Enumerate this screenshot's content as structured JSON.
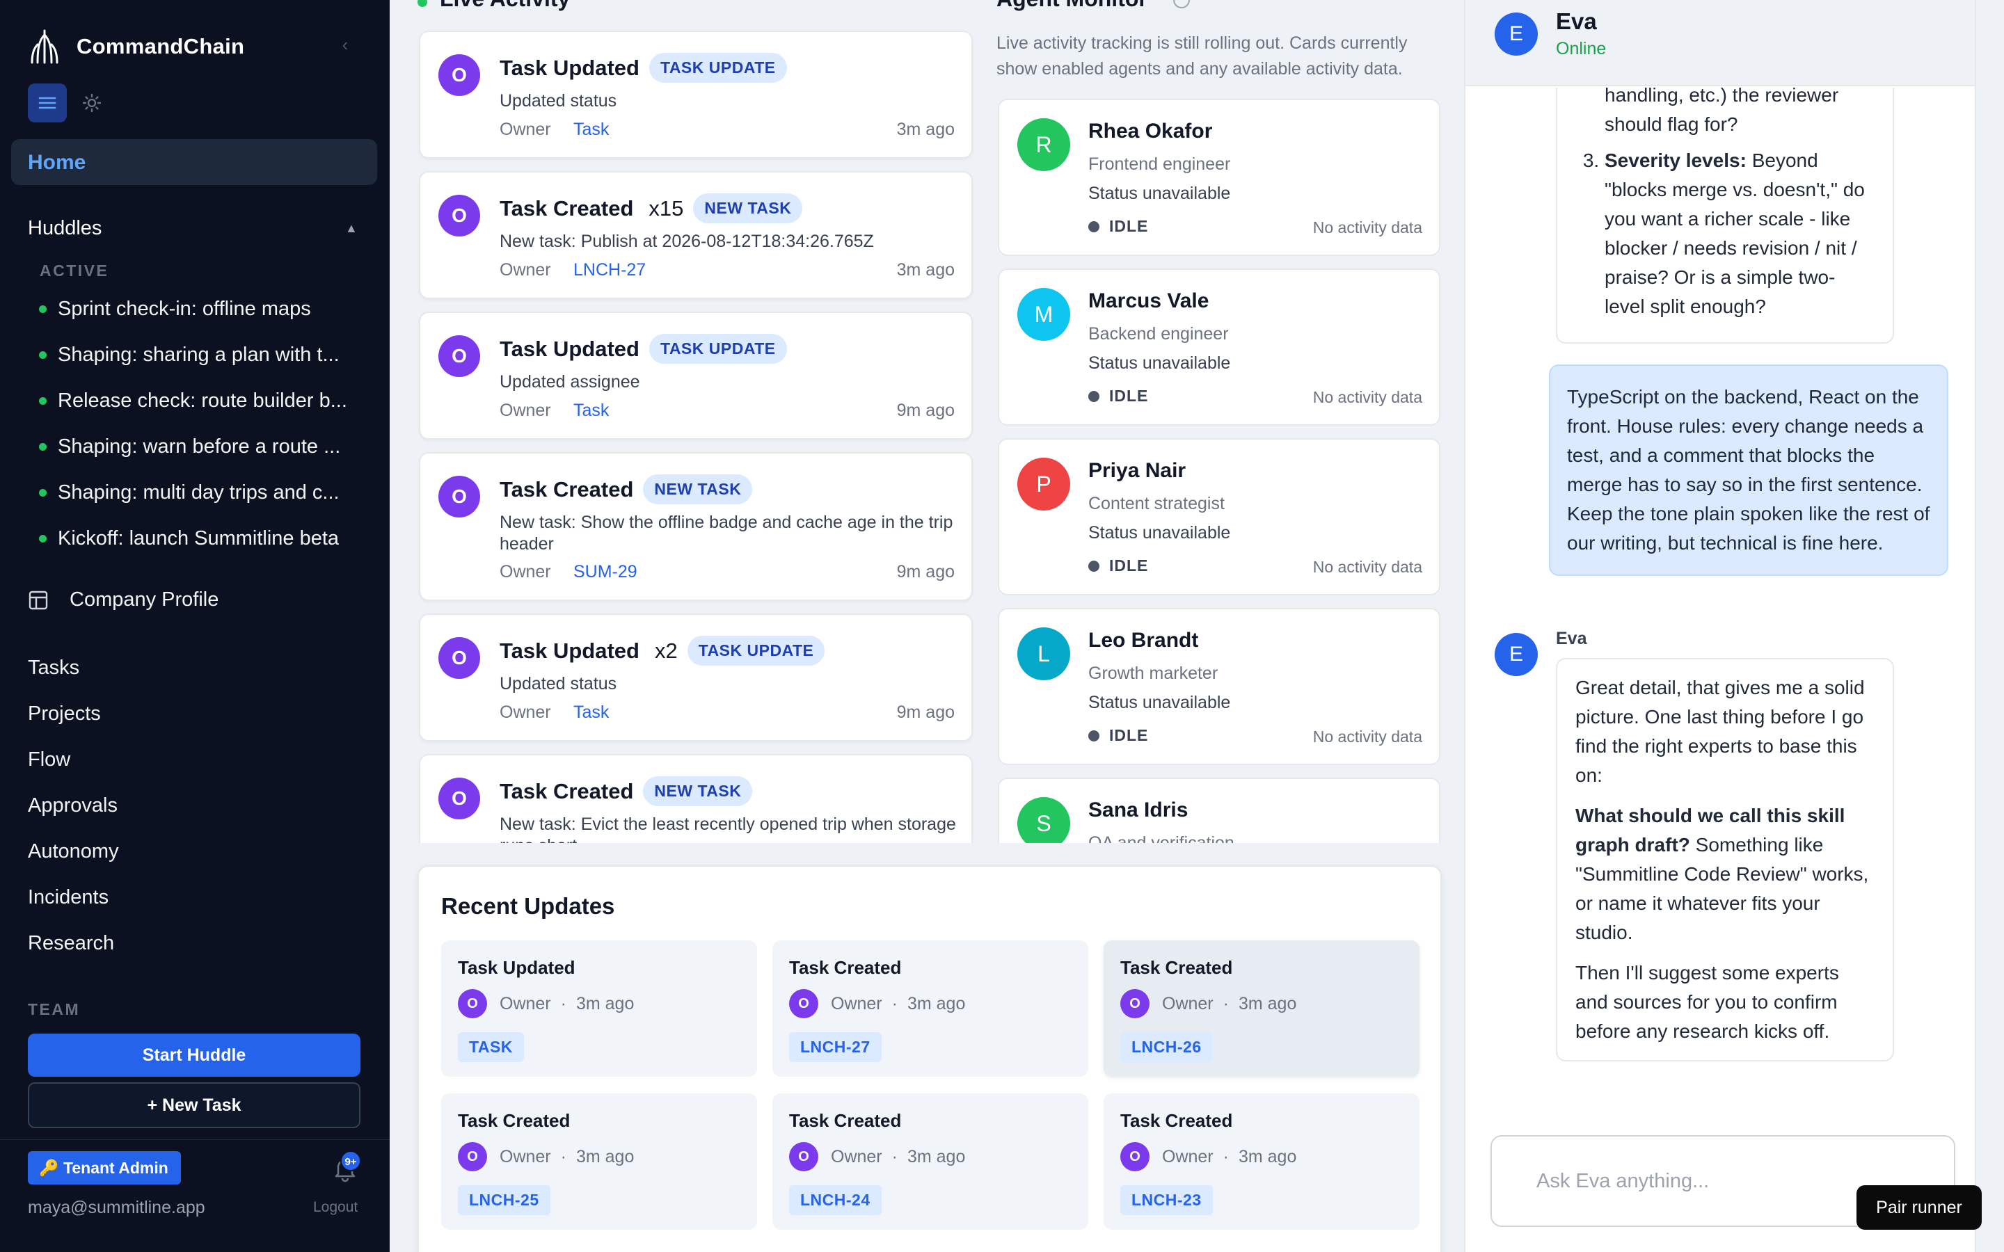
{
  "brand": {
    "name": "CommandChain"
  },
  "sidebar": {
    "home_label": "Home",
    "huddles_label": "Huddles",
    "active_label": "ACTIVE",
    "huddles": [
      "Sprint check-in: offline maps",
      "Shaping: sharing a plan with t...",
      "Release check: route builder b...",
      "Shaping: warn before a route ...",
      "Shaping: multi day trips and c...",
      "Kickoff: launch Summitline beta"
    ],
    "company_profile": "Company Profile",
    "nav": [
      "Tasks",
      "Projects",
      "Flow",
      "Approvals",
      "Autonomy",
      "Incidents",
      "Research"
    ],
    "team_label": "TEAM",
    "start_huddle": "Start Huddle",
    "new_task": "+ New Task",
    "tenant_badge": "🔑 Tenant Admin",
    "notification_count": "9+",
    "user_email": "maya@summitline.app",
    "logout": "Logout"
  },
  "live_activity": {
    "title": "Live Activity",
    "cards": [
      {
        "avatar": "O",
        "title": "Task Updated",
        "multiplier": "",
        "badge": "TASK UPDATE",
        "desc": "Updated status",
        "owner": "Owner",
        "link": "Task",
        "time": "3m ago"
      },
      {
        "avatar": "O",
        "title": "Task Created",
        "multiplier": "x15",
        "badge": "NEW TASK",
        "desc": "New task: Publish at 2026-08-12T18:34:26.765Z",
        "owner": "Owner",
        "link": "LNCH-27",
        "time": "3m ago"
      },
      {
        "avatar": "O",
        "title": "Task Updated",
        "multiplier": "",
        "badge": "TASK UPDATE",
        "desc": "Updated assignee",
        "owner": "Owner",
        "link": "Task",
        "time": "9m ago"
      },
      {
        "avatar": "O",
        "title": "Task Created",
        "multiplier": "",
        "badge": "NEW TASK",
        "desc": "New task: Show the offline badge and cache age in the trip header",
        "owner": "Owner",
        "link": "SUM-29",
        "time": "9m ago"
      },
      {
        "avatar": "O",
        "title": "Task Updated",
        "multiplier": "x2",
        "badge": "TASK UPDATE",
        "desc": "Updated status",
        "owner": "Owner",
        "link": "Task",
        "time": "9m ago"
      },
      {
        "avatar": "O",
        "title": "Task Created",
        "multiplier": "",
        "badge": "NEW TASK",
        "desc": "New task: Evict the least recently opened trip when storage runs short",
        "owner": "",
        "link": "",
        "time": ""
      }
    ]
  },
  "agent_monitor": {
    "title": "Agent Monitor",
    "description": "Live activity tracking is still rolling out. Cards currently show enabled agents and any available activity data.",
    "agents": [
      {
        "initial": "R",
        "name": "Rhea Okafor",
        "role": "Frontend engineer",
        "status": "Status unavailable",
        "state": "IDLE",
        "activity": "No activity data",
        "color": "#22c55e"
      },
      {
        "initial": "M",
        "name": "Marcus Vale",
        "role": "Backend engineer",
        "status": "Status unavailable",
        "state": "IDLE",
        "activity": "No activity data",
        "color": "#0ec5ef"
      },
      {
        "initial": "P",
        "name": "Priya Nair",
        "role": "Content strategist",
        "status": "Status unavailable",
        "state": "IDLE",
        "activity": "No activity data",
        "color": "#ef4444"
      },
      {
        "initial": "L",
        "name": "Leo Brandt",
        "role": "Growth marketer",
        "status": "Status unavailable",
        "state": "IDLE",
        "activity": "No activity data",
        "color": "#06a8c9"
      },
      {
        "initial": "S",
        "name": "Sana Idris",
        "role": "QA and verification",
        "status": "",
        "state": "",
        "activity": "",
        "color": "#22c55e"
      }
    ]
  },
  "recent_updates": {
    "title": "Recent Updates",
    "items": [
      {
        "title": "Task Updated",
        "avatar": "O",
        "owner": "Owner",
        "dot": "·",
        "time": "3m ago",
        "tag": "TASK"
      },
      {
        "title": "Task Created",
        "avatar": "O",
        "owner": "Owner",
        "dot": "·",
        "time": "3m ago",
        "tag": "LNCH-27"
      },
      {
        "title": "Task Created",
        "avatar": "O",
        "owner": "Owner",
        "dot": "·",
        "time": "3m ago",
        "tag": "LNCH-26"
      },
      {
        "title": "Task Created",
        "avatar": "O",
        "owner": "Owner",
        "dot": "·",
        "time": "3m ago",
        "tag": "LNCH-25"
      },
      {
        "title": "Task Created",
        "avatar": "O",
        "owner": "Owner",
        "dot": "·",
        "time": "3m ago",
        "tag": "LNCH-24"
      },
      {
        "title": "Task Created",
        "avatar": "O",
        "owner": "Owner",
        "dot": "·",
        "time": "3m ago",
        "tag": "LNCH-23"
      }
    ]
  },
  "chat": {
    "agent_initial": "E",
    "agent_name": "Eva",
    "status": "Online",
    "msg1_fragment": "handling, etc.) the reviewer should flag for?",
    "msg1_item_label": "Severity levels:",
    "msg1_item_text": "Beyond \"blocks merge vs. doesn't,\" do you want a richer scale - like blocker / needs revision / nit / praise? Or is a simple two-level split enough?",
    "user_msg": "TypeScript on the backend, React on the front. House rules: every change needs a test, and a comment that blocks the merge has to say so in the first sentence. Keep the tone plain spoken like the rest of our writing, but technical is fine here.",
    "sender": "Eva",
    "reply_p1": "Great detail, that gives me a solid picture. One last thing before I go find the right experts to base this on:",
    "reply_bold": "What should we call this skill graph draft?",
    "reply_p2_rest": "Something like \"Summitline Code Review\" works, or name it whatever fits your studio.",
    "reply_p3": "Then I'll suggest some experts and sources for you to confirm before any research kicks off.",
    "input_placeholder": "Ask Eva anything..."
  },
  "pair_runner": "Pair runner",
  "colors": {
    "accent": "#2563eb",
    "sidebar_bg": "#0b1120",
    "online": "#16a34a",
    "owner_avatar": "#7c3aed"
  }
}
